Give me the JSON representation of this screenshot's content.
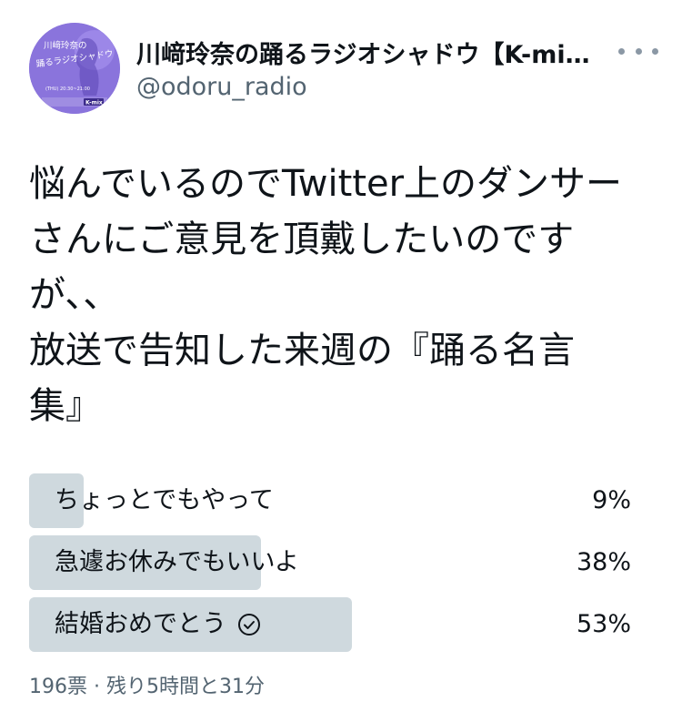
{
  "author": {
    "display_name": "川﨑玲奈の踊るラジオシャドウ【K-mi…",
    "handle": "@odoru_radio",
    "avatar": {
      "title_line1": "川﨑玲奈の",
      "title_line2": "踊るラジオシャドウ",
      "schedule": "(THU) 20:30~21:00",
      "station": "K-mix",
      "accent": "#8f78e0"
    }
  },
  "more_icon": "more-dots-icon",
  "tweet": {
    "lines": [
      "悩んでいるのでTwitter上のダンサー",
      "さんにご意見を頂戴したいのです",
      "が、、",
      "放送で告知した来週の『踊る名言",
      "集』"
    ]
  },
  "poll": {
    "options": [
      {
        "label": "ちょっとでもやって",
        "percent": 9,
        "percent_text": "9%",
        "winner": false
      },
      {
        "label": "急遽お休みでもいいよ",
        "percent": 38,
        "percent_text": "38%",
        "winner": false
      },
      {
        "label": "結婚おめでとう",
        "percent": 53,
        "percent_text": "53%",
        "winner": true,
        "icon": "check-circle-icon"
      }
    ],
    "meta": "196票 · 残り5時間と31分",
    "bar_color": "#cfd9de"
  }
}
